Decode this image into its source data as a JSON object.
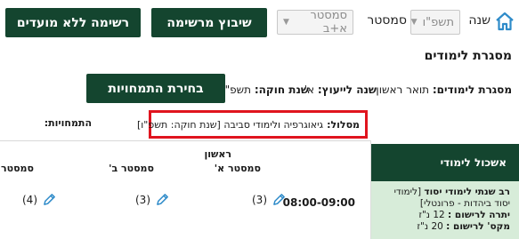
{
  "topbar": {
    "year_label": "שנה",
    "year_value": "תשפ\"ו",
    "semester_label": "סמסטר",
    "semester_value": "סמסטר א+ב",
    "assign_button": "שיבוץ מרשימה",
    "list_button": "רשימה ללא מועדים"
  },
  "page_title": "מסגרת לימודים",
  "info": {
    "framework_label": "מסגרת לימודים:",
    "framework_value": "תואר ראשון",
    "advisor_year_label": "שנה לייעוץ:",
    "advisor_year_value": "א'",
    "law_year_label": "שנת חוקה:",
    "law_year_value": "תשפ\"ו",
    "spec_button": "בחירת התמחויות"
  },
  "path": {
    "label": "מסלול:",
    "value": "גיאוגרפיה ולימודי סביבה [שנת חוקה: תשפ\"ו]"
  },
  "specializations_label": "התמחויות:",
  "sidebar": {
    "header": "אשכול לימודי",
    "card_title": "רב שנתי לימודי יסוד",
    "card_desc": "[לימודי יסוד ביהדות - פרונטלי]",
    "card_min_label": "יתרה לרישום :",
    "card_min_value": "12 נ\"ז",
    "card_max_label": "מקס' לרישום :",
    "card_max_value": "20 נ\"ז"
  },
  "grid": {
    "year_header": "ראשון",
    "semester_a": "סמסטר א'",
    "semester_b": "סמסטר ב'",
    "semester_c": "סמסטר",
    "time_slot": "08:00-09:00",
    "cells": [
      "(3)",
      "(3)",
      "(4)"
    ]
  },
  "colors": {
    "primary": "#14452f",
    "highlight_border": "#e0141e",
    "card_bg": "#d7ecd9",
    "pencil": "#2e8bc9"
  }
}
